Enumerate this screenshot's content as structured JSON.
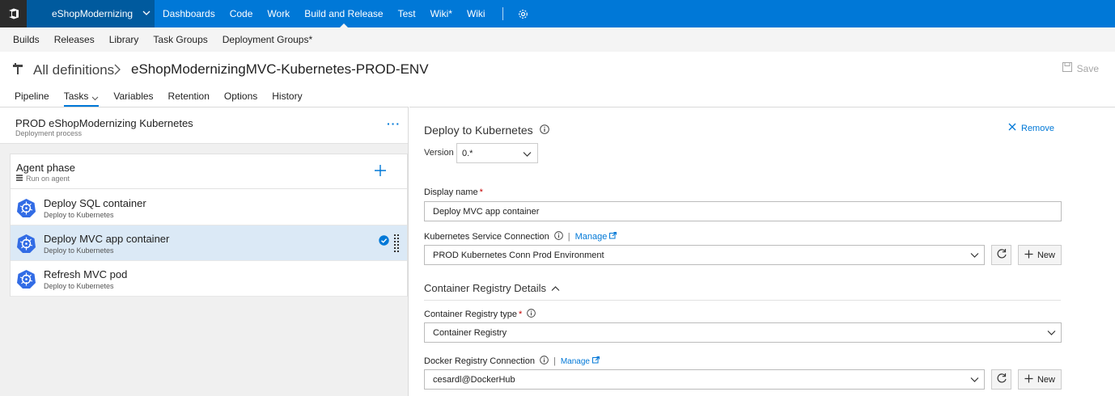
{
  "topnav": {
    "project": "eShopModernizing",
    "items": [
      {
        "label": "Dashboards",
        "active": false
      },
      {
        "label": "Code",
        "active": false
      },
      {
        "label": "Work",
        "active": false
      },
      {
        "label": "Build and Release",
        "active": true
      },
      {
        "label": "Test",
        "active": false
      },
      {
        "label": "Wiki*",
        "active": false
      },
      {
        "label": "Wiki",
        "active": false
      }
    ]
  },
  "subnav": {
    "items": [
      "Builds",
      "Releases",
      "Library",
      "Task Groups",
      "Deployment Groups*"
    ]
  },
  "header": {
    "breadcrumb_root": "All definitions",
    "definition_title": "eShopModernizingMVC-Kubernetes-PROD-ENV",
    "save_label": "Save"
  },
  "tabs": [
    "Pipeline",
    "Tasks",
    "Variables",
    "Retention",
    "Options",
    "History"
  ],
  "left": {
    "stage_title": "PROD eShopModernizing Kubernetes",
    "stage_subtitle": "Deployment process",
    "phase_title": "Agent phase",
    "phase_subtitle": "Run on agent",
    "tasks": [
      {
        "title": "Deploy SQL container",
        "subtitle": "Deploy to Kubernetes"
      },
      {
        "title": "Deploy MVC app container",
        "subtitle": "Deploy to Kubernetes"
      },
      {
        "title": "Refresh MVC pod",
        "subtitle": "Deploy to Kubernetes"
      }
    ]
  },
  "right": {
    "task_title": "Deploy to Kubernetes",
    "remove_label": "Remove",
    "version_label": "Version",
    "version_value": "0.*",
    "display_name_label": "Display name",
    "display_name_value": "Deploy MVC app container",
    "k8s_conn_label": "Kubernetes Service Connection",
    "manage_label": "Manage",
    "k8s_conn_value": "PROD Kubernetes Conn Prod Environment",
    "new_label": "New",
    "section_title": "Container Registry Details",
    "registry_type_label": "Container Registry type",
    "registry_type_value": "Container Registry",
    "docker_conn_label": "Docker Registry Connection",
    "docker_conn_value": "cesardl@DockerHub",
    "required_mark": "*",
    "pipe": "|"
  },
  "colors": {
    "nav_blue": "#0078d7",
    "project_blue": "#005a9e",
    "selected_row": "#dbe9f6",
    "k8s_blue": "#326ce5"
  }
}
